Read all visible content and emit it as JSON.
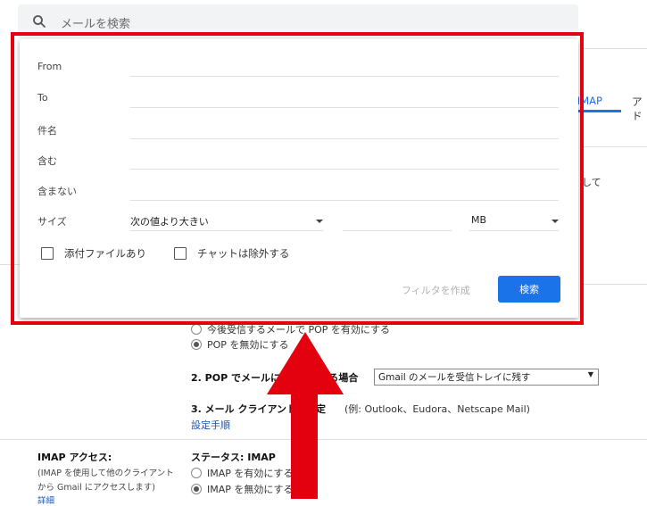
{
  "search": {
    "placeholder": "メールを検索",
    "icon": "search-icon"
  },
  "tabs": {
    "popimap": "P/IMAP",
    "other": "アド"
  },
  "background": {
    "right_fragment": "して",
    "pop_option_1": "今後受信するメールで POP を有効にする",
    "pop_option_2": "POP を無効にする",
    "pop_section_2_label": "2. POP でメールにアクセスする場合",
    "pop_section_2_select": "Gmail のメールを受信トレイに残す",
    "pop_section_3_label": "3. メール クライアントの設定",
    "pop_section_3_hint": "(例: Outlook、Eudora、Netscape Mail)",
    "setup_link": "設定手順",
    "imap_title": "IMAP アクセス:",
    "imap_desc_1": "(IMAP を使用して他のクライアント",
    "imap_desc_2": "から Gmail にアクセスします)",
    "imap_link": "詳細",
    "imap_status": "ステータス: IMAP",
    "imap_enable": "IMAP を有効にする",
    "imap_disable": "IMAP を無効にする"
  },
  "dialog": {
    "fields": [
      {
        "label": "From",
        "value": ""
      },
      {
        "label": "To",
        "value": ""
      },
      {
        "label": "件名",
        "value": ""
      },
      {
        "label": "含む",
        "value": ""
      },
      {
        "label": "含まない",
        "value": ""
      }
    ],
    "size_label": "サイズ",
    "size_operator": "次の値より大きい",
    "size_value": "",
    "size_unit": "MB",
    "has_attachment": "添付ファイルあり",
    "exclude_chats": "チャットは除外する",
    "create_filter": "フィルタを作成",
    "search_button": "検索"
  },
  "colors": {
    "accent": "#1a73e8",
    "highlight": "#e3000f"
  }
}
